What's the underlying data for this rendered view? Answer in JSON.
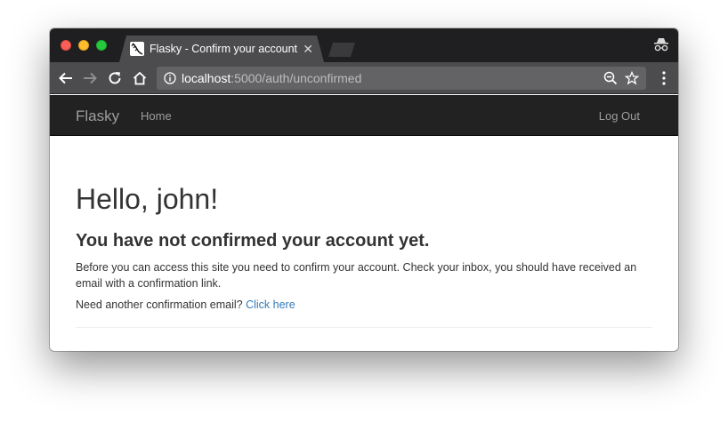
{
  "browser": {
    "tab_title": "Flasky - Confirm your account",
    "tab_close": "✕",
    "url_host": "localhost",
    "url_rest": ":5000/auth/unconfirmed"
  },
  "navbar": {
    "brand": "Flasky",
    "home": "Home",
    "logout": "Log Out"
  },
  "page": {
    "heading": "Hello, john!",
    "subheading": "You have not confirmed your account yet.",
    "message": "Before you can access this site you need to confirm your account. Check your inbox, you should have received an email with a confirmation link.",
    "resend_prompt": "Need another confirmation email?",
    "resend_link": "Click here"
  },
  "colors": {
    "navbar_bg": "#222222",
    "link": "#337ab7",
    "text": "#333333"
  }
}
